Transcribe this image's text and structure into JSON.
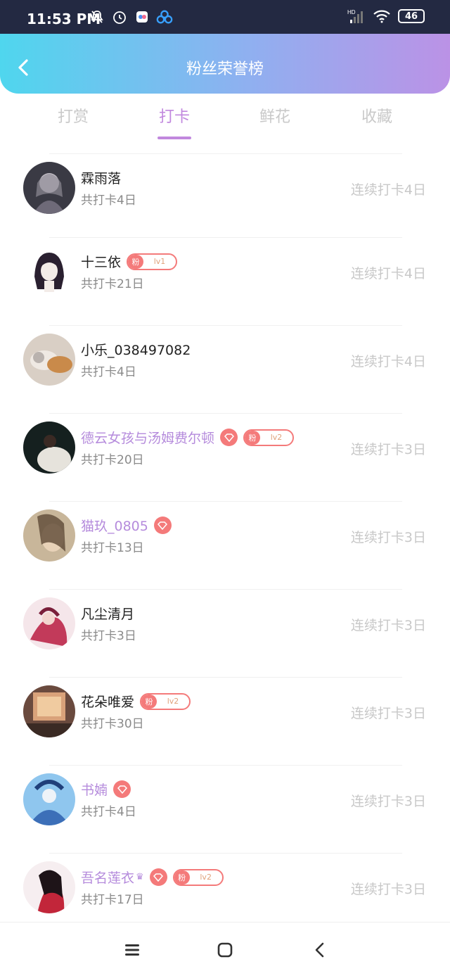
{
  "status_bar": {
    "time": "11:53 PM",
    "battery": "46",
    "hd": "HD",
    "icons": [
      "mute-bell-icon",
      "alarm-icon",
      "app-icon",
      "app-icon-2",
      "signal-icon",
      "wifi-icon",
      "battery-icon"
    ]
  },
  "header": {
    "title": "粉丝荣誉榜"
  },
  "tabs": [
    {
      "label": "打赏",
      "active": false
    },
    {
      "label": "打卡",
      "active": true
    },
    {
      "label": "鲜花",
      "active": false
    },
    {
      "label": "收藏",
      "active": false
    }
  ],
  "list": [
    {
      "name": "霖雨落",
      "total": "共打卡4日",
      "streak": "连续打卡4日",
      "vip": false,
      "diamond": false,
      "fan_level": null,
      "crown": false
    },
    {
      "name": "十三依",
      "total": "共打卡21日",
      "streak": "连续打卡4日",
      "vip": false,
      "diamond": false,
      "fan_label": "粉",
      "fan_level": "lv1",
      "crown": false
    },
    {
      "name": "小乐_038497082",
      "total": "共打卡4日",
      "streak": "连续打卡4日",
      "vip": false,
      "diamond": false,
      "fan_level": null,
      "crown": false
    },
    {
      "name": "德云女孩与汤姆费尔顿",
      "total": "共打卡20日",
      "streak": "连续打卡3日",
      "vip": true,
      "diamond": true,
      "fan_label": "粉",
      "fan_level": "lv2",
      "crown": false
    },
    {
      "name": "猫玖_0805",
      "total": "共打卡13日",
      "streak": "连续打卡3日",
      "vip": true,
      "diamond": true,
      "fan_level": null,
      "crown": false
    },
    {
      "name": "凡尘清月",
      "total": "共打卡3日",
      "streak": "连续打卡3日",
      "vip": false,
      "diamond": false,
      "fan_level": null,
      "crown": false
    },
    {
      "name": "花朵唯爱",
      "total": "共打卡30日",
      "streak": "连续打卡3日",
      "vip": false,
      "diamond": false,
      "fan_label": "粉",
      "fan_level": "lv2",
      "crown": false
    },
    {
      "name": "书婻",
      "total": "共打卡4日",
      "streak": "连续打卡3日",
      "vip": true,
      "diamond": true,
      "fan_level": null,
      "crown": false
    },
    {
      "name": "吾名莲衣",
      "total": "共打卡17日",
      "streak": "连续打卡3日",
      "vip": true,
      "diamond": true,
      "fan_label": "粉",
      "fan_level": "lv2",
      "crown": true
    }
  ],
  "colors": {
    "accent": "#c188de",
    "vip_name": "#b58bdc",
    "badge": "#f47a7a",
    "header_gradient": [
      "#4fd6ee",
      "#bb92e6"
    ]
  },
  "nav": {
    "icons": [
      "menu-icon",
      "home-square-icon",
      "back-chevron-icon"
    ]
  }
}
